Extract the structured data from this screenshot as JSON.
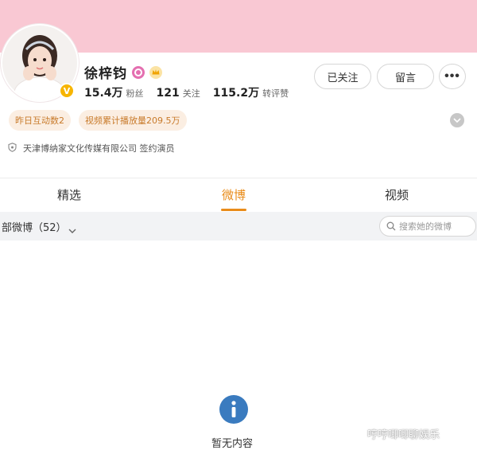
{
  "profile": {
    "name": "徐梓钧",
    "stats": [
      {
        "num": "15.4万",
        "label": "粉丝"
      },
      {
        "num": "121",
        "label": "关注"
      },
      {
        "num": "115.2万",
        "label": "转评赞"
      }
    ],
    "tags": [
      "昨日互动数2",
      "视频累计播放量209.5万"
    ],
    "company": "天津博纳家文化传媒有限公司 签约演员"
  },
  "actions": {
    "follow_label": "已关注",
    "message_label": "留言",
    "more_label": "•••"
  },
  "tabs": [
    {
      "label": "精选",
      "active": false
    },
    {
      "label": "微博",
      "active": true
    },
    {
      "label": "视频",
      "active": false
    }
  ],
  "filter": {
    "label": "部微博（52）",
    "search_placeholder": "搜索她的微博"
  },
  "empty_state": {
    "message": "暂无内容"
  },
  "watermark": {
    "text": "哼哼唧唧聊娱乐"
  },
  "colors": {
    "banner": "#f9c8d3",
    "accent": "#e98c1a",
    "tag_bg": "#fbeee2",
    "tag_text": "#c87a2a",
    "info_icon": "#3a7bbf"
  }
}
